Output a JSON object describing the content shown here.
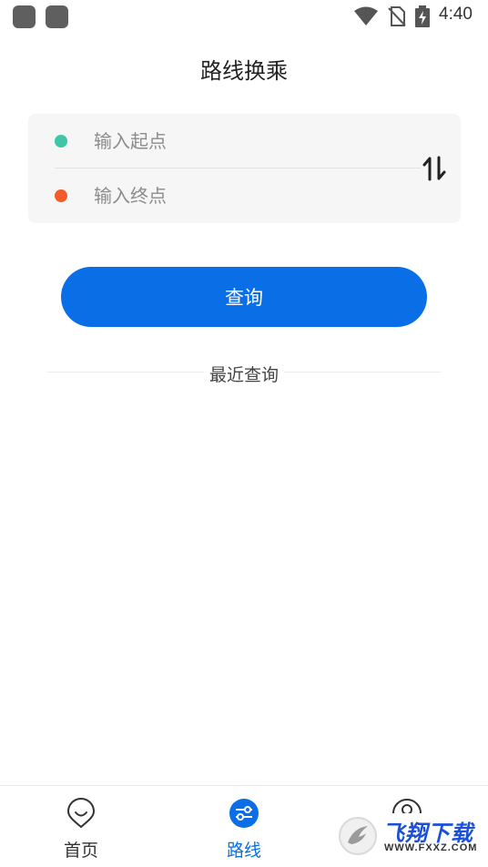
{
  "status_bar": {
    "time": "4:40",
    "icons": [
      "notification-app-icon",
      "notification-app-icon",
      "wifi-icon",
      "no-sim-icon",
      "battery-charging-icon"
    ]
  },
  "header": {
    "title": "路线换乘"
  },
  "route_form": {
    "start_placeholder": "输入起点",
    "end_placeholder": "输入终点",
    "start_dot_color": "#3ec6a6",
    "end_dot_color": "#f35a2c",
    "swap_icon": "swap-vertical-icon"
  },
  "query_button": {
    "label": "查询",
    "color": "#0a6ee6"
  },
  "recent": {
    "title": "最近查询"
  },
  "tab_bar": {
    "tabs": [
      {
        "label": "首页",
        "icon": "home-smile-icon",
        "active": false
      },
      {
        "label": "路线",
        "icon": "route-settings-icon",
        "active": true
      },
      {
        "label": "",
        "icon": "user-icon",
        "active": false
      }
    ],
    "active_color": "#0a6ee6"
  },
  "watermark": {
    "name": "飞翔下载",
    "url": "WWW.FXXZ.COM"
  }
}
